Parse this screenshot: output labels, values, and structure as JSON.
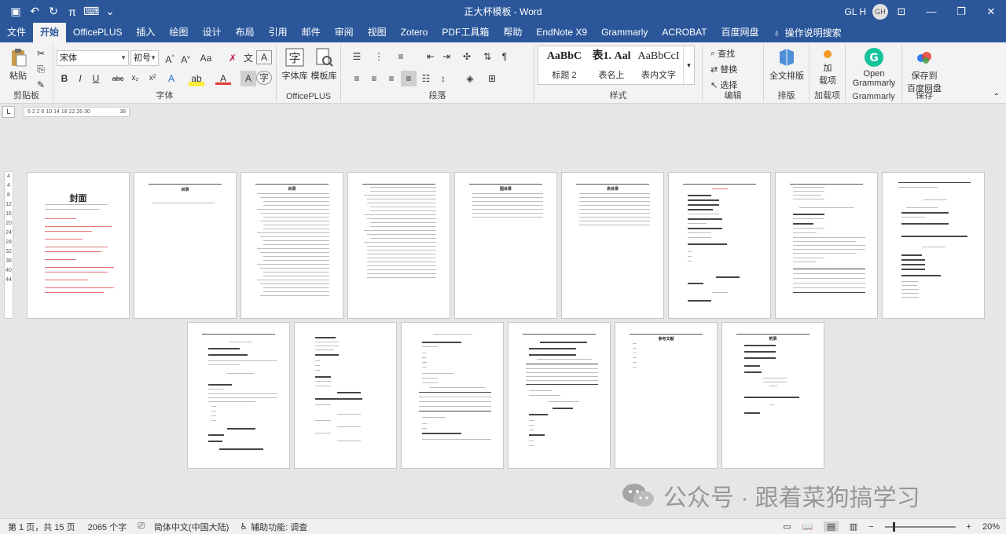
{
  "titlebar": {
    "title": "正大杯模板 - Word",
    "user": "GL H",
    "avatar": "GH",
    "qat_icons": [
      "save-icon",
      "undo-icon",
      "redo-icon",
      "pi-icon",
      "format-icon",
      "more-icon"
    ],
    "qat_glyphs": [
      "🖫",
      "↶",
      "↺",
      "π",
      "⌨",
      "⌄"
    ]
  },
  "tabs": [
    "文件",
    "开始",
    "OfficePLUS",
    "插入",
    "绘图",
    "设计",
    "布局",
    "引用",
    "邮件",
    "审阅",
    "视图",
    "Zotero",
    "PDF工具箱",
    "帮助",
    "EndNote X9",
    "Grammarly",
    "ACROBAT",
    "百度网盘"
  ],
  "tellme": "操作说明搜索",
  "ribbon": {
    "clipboard": {
      "paste": "粘贴",
      "label": "剪贴板"
    },
    "font": {
      "name": "宋体",
      "size": "初号",
      "label": "字体",
      "row1": [
        "A",
        "A",
        "Aa",
        "✎",
        "wén",
        "A"
      ],
      "row2": [
        "B",
        "I",
        "U",
        "abc",
        "x₂",
        "x²",
        "A",
        "ab",
        "A",
        "A",
        "A"
      ]
    },
    "officeplus": {
      "b1": "字体库",
      "b2": "模板库",
      "label": "OfficePLUS"
    },
    "paragraph": {
      "label": "段落"
    },
    "styles": {
      "items": [
        {
          "sample": "AaBbC",
          "name": "标题 2"
        },
        {
          "sample": "表1. Aal",
          "name": "表名上"
        },
        {
          "sample": "AaBbCcI",
          "name": "表内文字"
        }
      ],
      "label": "样式"
    },
    "editing": {
      "find": "查找",
      "replace": "替换",
      "select": "选择",
      "label": "编辑"
    },
    "layout": {
      "btn": "全文排版",
      "label": "排版"
    },
    "addin": {
      "btn1": "加",
      "btn2": "载项",
      "label": "加载项"
    },
    "grammarly": {
      "btn1": "Open",
      "btn2": "Grammarly",
      "label": "Grammarly"
    },
    "save": {
      "btn1": "保存到",
      "btn2": "百度网盘",
      "label": "保存"
    }
  },
  "ruler": {
    "ticks": "6  2  2  6  10 14 18 22 26 30",
    "end": "38",
    "vticks": [
      "4",
      "4",
      "8",
      "12",
      "16",
      "20",
      "24",
      "28",
      "32",
      "36",
      "40",
      "44"
    ]
  },
  "pages": {
    "cover_title": "封面",
    "toc_title": "目录",
    "figs_title": "图目录",
    "tables_title": "表目录",
    "ref_title": "参考文献",
    "appendix_title": "附录"
  },
  "watermark": "公众号 · 跟着菜狗搞学习",
  "status": {
    "page": "第 1 页，共 15 页",
    "words": "2065 个字",
    "lang": "简体中文(中国大陆)",
    "access": "辅助功能: 调查",
    "zoom": "20%"
  }
}
